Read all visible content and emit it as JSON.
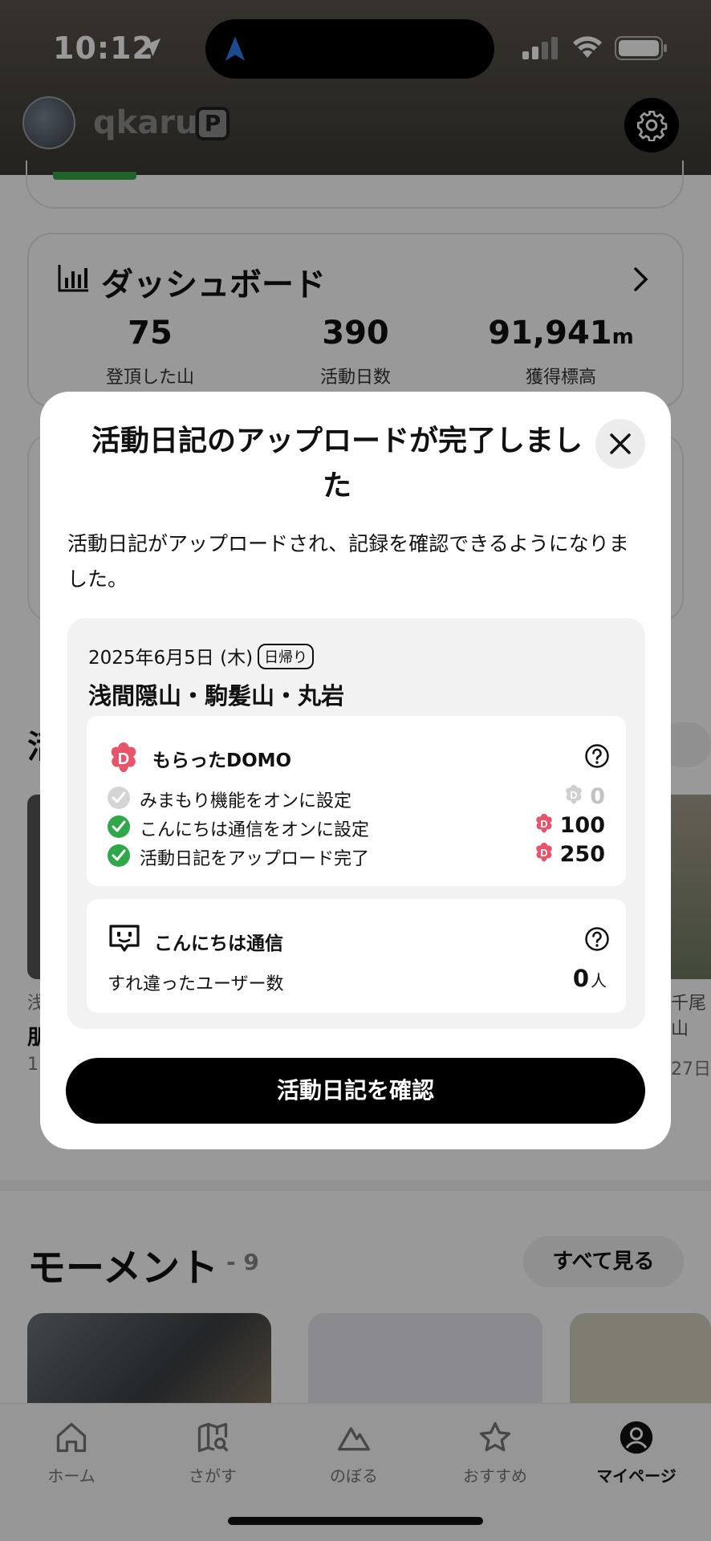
{
  "status_bar": {
    "time": "10:12"
  },
  "profile": {
    "username": "qkaru",
    "premium_badge": "P"
  },
  "dashboard": {
    "title": "ダッシュボード",
    "stats": [
      {
        "value": "75",
        "unit": "",
        "label": "登頂した山"
      },
      {
        "value": "390",
        "unit": "",
        "label": "活動日数"
      },
      {
        "value": "91,941",
        "unit": "m",
        "label": "獲得標高"
      }
    ]
  },
  "background": {
    "section_partial": "活",
    "left_card": {
      "line1": "浅",
      "line2": "朋",
      "line3": "1"
    },
    "right_card": {
      "line1": "千尾山",
      "line3": "27日"
    }
  },
  "moments": {
    "title": "モーメント",
    "count": "- 9",
    "see_all": "すべて見る"
  },
  "tabbar": {
    "tabs": [
      {
        "label": "ホーム",
        "icon": "home-icon"
      },
      {
        "label": "さがす",
        "icon": "map-search-icon"
      },
      {
        "label": "のぼる",
        "icon": "mountain-icon"
      },
      {
        "label": "おすすめ",
        "icon": "star-icon"
      },
      {
        "label": "マイページ",
        "icon": "user-icon",
        "active": true
      }
    ]
  },
  "modal": {
    "title": "活動日記のアップロードが完了しました",
    "description": "活動日記がアップロードされ、記録を確認できるようになりました。",
    "record": {
      "date": "2025年6月5日 (木)",
      "badge": "日帰り",
      "title": "浅間隠山・駒髪山・丸岩"
    },
    "domo": {
      "title": "もらったDOMO",
      "rows": [
        {
          "label": "みまもり機能をオンに設定",
          "points": "0",
          "done": false
        },
        {
          "label": "こんにちは通信をオンに設定",
          "points": "100",
          "done": true
        },
        {
          "label": "活動日記をアップロード完了",
          "points": "250",
          "done": true
        }
      ]
    },
    "konnichiwa": {
      "title": "こんにちは通信",
      "label": "すれ違ったユーザー数",
      "value": "0",
      "unit": "人"
    },
    "primary_button": "活動日記を確認"
  },
  "colors": {
    "domo_pink": "#e8556b",
    "check_green": "#2fa84a",
    "check_gray": "#d4d4d4"
  }
}
